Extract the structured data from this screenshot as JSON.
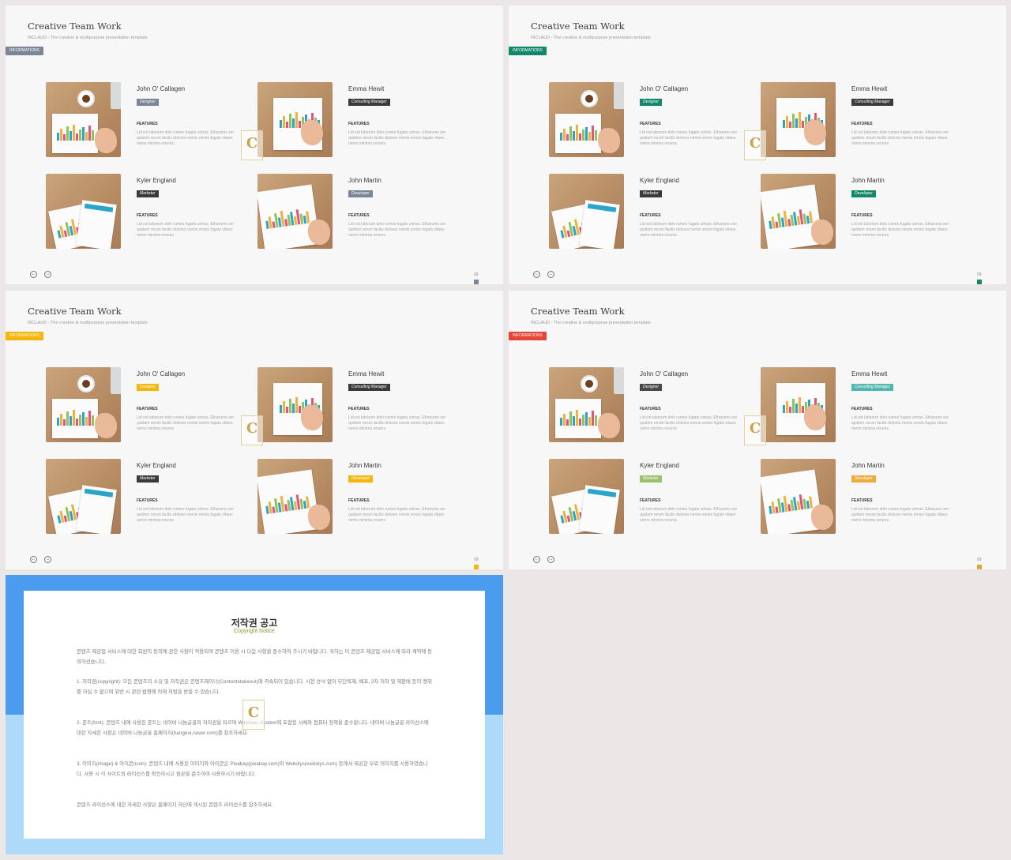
{
  "slides": [
    {
      "accent": "#7a8596",
      "tag_color": "#7a8596",
      "role_colors": [
        "#7a8596",
        "#3a3a3a",
        "#3a3a3a",
        "#7a8596"
      ]
    },
    {
      "accent": "#13876b",
      "tag_color": "#13876b",
      "role_colors": [
        "#13876b",
        "#3a3a3a",
        "#3a3a3a",
        "#13876b"
      ]
    },
    {
      "accent": "#f4b60a",
      "tag_color": "#f4b60a",
      "role_colors": [
        "#f4b60a",
        "#3a3a3a",
        "#3a3a3a",
        "#f4b60a"
      ]
    },
    {
      "accent": "#e9a62a",
      "tag_color": "#e4453a",
      "role_colors": [
        "#4a4a4a",
        "#52b7b0",
        "#9bc16a",
        "#f0a93a"
      ]
    }
  ],
  "title": "Creative Team Work",
  "subtitle": "INCLAUD - The creative & multipurpose presentation template",
  "tag": "INFORMATIONS",
  "page_number": "09",
  "features_label": "FEATURES",
  "description": "Lid est laborum dolo rumes fugats untras. Etharums ser quidem rerum facilis dolores nemis omnis fugats vitaes nemo minima rerums",
  "members": [
    {
      "name": "John O' Callagen",
      "role": "Designer"
    },
    {
      "name": "Emma Hewit",
      "role": "Consulting Manager"
    },
    {
      "name": "Kyler England",
      "role": "Marketer"
    },
    {
      "name": "John Martin",
      "role": "Developer"
    }
  ],
  "nav": {
    "prev": "←",
    "next": "→"
  },
  "watermark_letter": "C",
  "copyright": {
    "title": "저작권 공고",
    "subtitle": "Copyright Notice",
    "paragraphs": [
      "콘텐츠 제공업 서비스에 대한 회원의 동의에 관한 사항이 적용되며 콘텐츠 이용 시 다음 사항을 준수하여 주시기 바랍니다. 귀하는 이 콘텐츠 제공업 서비스에 따라 계약에 동의하셨습니다.",
      "1. 저작권(copyright): 모든 콘텐츠의 소유 및 저작권은 콘텐츠제이너(Contentstakeout)에 귀속되어 있습니다. 사전 승낙 없이 무단복제, 배포, 2차 저작 및 재판매 등의 행위를 하실 수 없으며 위반 시 관련 법령에 의해 처벌을 받을 수 있습니다.",
      "2. 폰트(font): 콘텐츠 내에 사용된 폰트는 네이버 나눔글꼴의 저작권을 따르며 Windows System에 포함된 서체와 컴퓨터 정책을 준수합니다. 네이버 나눔글꼴 라이선스에 대한 자세한 사항은 네이버 나눔글꼴 홈페이지(hangeul.naver.com)를 참조하세요.",
      "3. 이미지(image) & 아이콘(icon): 콘텐츠 내에 사용된 이미지와 아이콘은 Pixabay(pixabay.com)와 Webolys(webolys.com) 등에서 제공한 무료 이미지를 사용하였습니다. 사용 시 각 사이트의 라이선스를 확인하시고 원본을 준수하여 사용하시기 바랍니다.",
      "콘텐츠 라이선스에 대한 자세한 사항은 홈페이지 하단에 게시된 콘텐츠 라이선스를 참조하세요."
    ]
  }
}
